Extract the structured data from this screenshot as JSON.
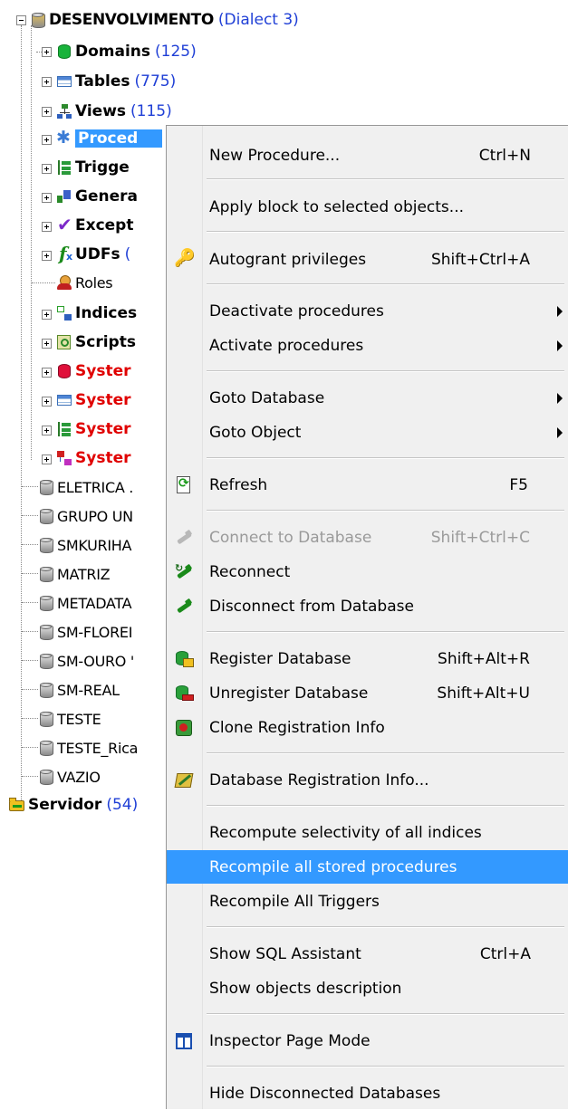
{
  "tree": {
    "root": {
      "label": "DESENVOLVIMENTO",
      "dialect": "(Dialect 3)"
    },
    "children": [
      {
        "label": "Domains",
        "count": "(125)",
        "icon": "domain-icon"
      },
      {
        "label": "Tables",
        "count": "(775)",
        "icon": "table-icon"
      },
      {
        "label": "Views",
        "count": "(115)",
        "icon": "view-icon"
      },
      {
        "label": "Proced",
        "icon": "procedure-icon"
      },
      {
        "label": "Trigge",
        "icon": "trigger-icon"
      },
      {
        "label": "Genera",
        "icon": "generator-icon"
      },
      {
        "label": "Except",
        "icon": "exception-icon"
      },
      {
        "label": "UDFs",
        "count": "(",
        "icon": "udf-icon"
      },
      {
        "label": "Roles",
        "icon": "role-icon"
      },
      {
        "label": "Indices",
        "icon": "index-icon"
      },
      {
        "label": "Scripts",
        "icon": "script-icon"
      },
      {
        "label": "Syster",
        "icon": "system-domain-icon"
      },
      {
        "label": "Syster",
        "icon": "system-table-icon"
      },
      {
        "label": "Syster",
        "icon": "system-trigger-icon"
      },
      {
        "label": "Syster",
        "icon": "system-index-icon"
      }
    ],
    "databases": [
      "ELETRICA .",
      "GRUPO UN",
      "SMKURIHA",
      "MATRIZ",
      "METADATA",
      "SM-FLOREI",
      "SM-OURO '",
      "SM-REAL",
      "TESTE",
      "TESTE_Rica",
      "VAZIO"
    ],
    "server": {
      "label": "Servidor",
      "count": "(54)"
    }
  },
  "menu": {
    "new_procedure": {
      "label": "New Procedure...",
      "shortcut": "Ctrl+N"
    },
    "apply_block": {
      "label": "Apply block to selected objects..."
    },
    "autogrant": {
      "label": "Autogrant privileges",
      "shortcut": "Shift+Ctrl+A"
    },
    "deactivate": {
      "label": "Deactivate procedures"
    },
    "activate": {
      "label": "Activate procedures"
    },
    "goto_database": {
      "label": "Goto Database"
    },
    "goto_object": {
      "label": "Goto Object"
    },
    "refresh": {
      "label": "Refresh",
      "shortcut": "F5"
    },
    "connect": {
      "label": "Connect to Database",
      "shortcut": "Shift+Ctrl+C"
    },
    "reconnect": {
      "label": "Reconnect"
    },
    "disconnect": {
      "label": "Disconnect from Database"
    },
    "register": {
      "label": "Register Database",
      "shortcut": "Shift+Alt+R"
    },
    "unregister": {
      "label": "Unregister Database",
      "shortcut": "Shift+Alt+U"
    },
    "clone": {
      "label": "Clone Registration Info"
    },
    "reg_info": {
      "label": "Database Registration Info..."
    },
    "recompute": {
      "label": "Recompute selectivity of all indices"
    },
    "recompile_procs": {
      "label": "Recompile all stored procedures"
    },
    "recompile_triggers": {
      "label": "Recompile All Triggers"
    },
    "sql_assistant": {
      "label": "Show SQL Assistant",
      "shortcut": "Ctrl+A"
    },
    "objects_desc": {
      "label": "Show objects description"
    },
    "inspector": {
      "label": "Inspector Page Mode"
    },
    "hide_disconnected": {
      "label": "Hide Disconnected Databases"
    }
  },
  "colors": {
    "selection": "#3399ff",
    "count_text": "#1f3fd6",
    "system_text": "#e00000",
    "menu_bg": "#f0f0f0"
  }
}
